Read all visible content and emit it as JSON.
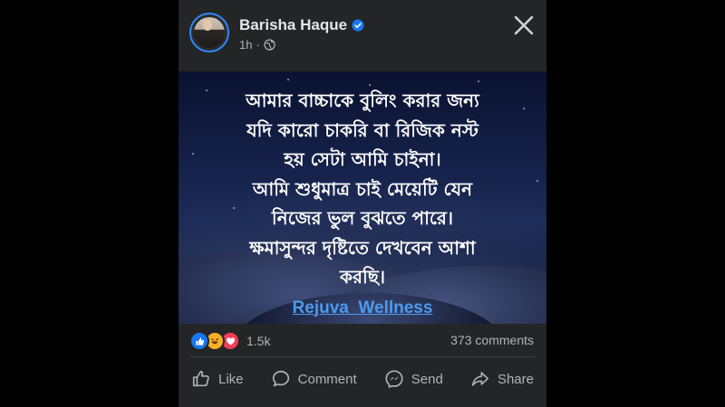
{
  "header": {
    "author_name": "Barisha Haque",
    "time": "1h",
    "verified_icon": "verified-badge-icon",
    "audience_icon": "globe-icon",
    "close_icon": "close-icon"
  },
  "image_post": {
    "lines": [
      "আমার বাচ্চাকে বুলিং করার জন্য",
      "যদি কারো চাকরি বা রিজিক নস্ট",
      "হয় সেটা আমি চাইনা।",
      "আমি শুধুমাত্র চাই মেয়েটি যেন",
      "নিজের ভুল বুঝতে পারে।",
      "ক্ষমাসুন্দর দৃষ্টিতে দেখবেন আশা",
      "করছি।"
    ],
    "brand": "Rejuva  Wellness"
  },
  "stats": {
    "reactions": [
      "like",
      "haha",
      "love"
    ],
    "reaction_count": "1.5k",
    "comments": "373 comments"
  },
  "actions": {
    "like": "Like",
    "comment": "Comment",
    "send": "Send",
    "share": "Share"
  },
  "colors": {
    "background": "#000000",
    "card": "#242526",
    "link": "#4c9bf0",
    "like_blue": "#1877f2",
    "love_red": "#f33e58",
    "haha_yellow": "#f7b125"
  }
}
